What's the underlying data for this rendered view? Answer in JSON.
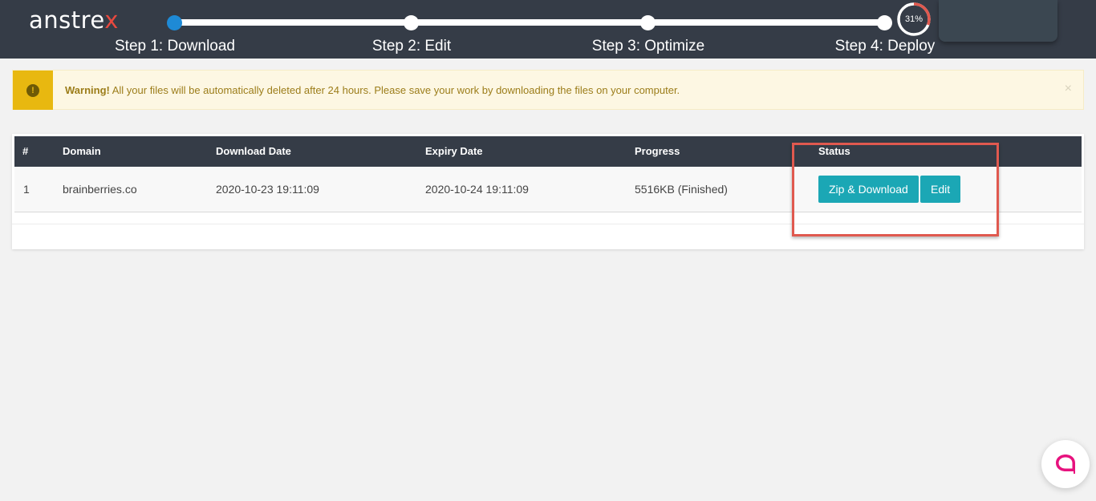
{
  "header": {
    "logo_main": "anstre",
    "logo_accent": "x",
    "steps": [
      {
        "label": "Step 1: Download"
      },
      {
        "label": "Step 2: Edit"
      },
      {
        "label": "Step 3: Optimize"
      },
      {
        "label": "Step 4: Deploy"
      }
    ],
    "progress_label": "31%",
    "progress_value": 31
  },
  "alert": {
    "title": "Warning!",
    "message": " All your files will be automatically deleted after 24 hours. Please save your work by downloading the files on your computer.",
    "close_label": "×"
  },
  "table": {
    "columns": [
      "#",
      "Domain",
      "Download Date",
      "Expiry Date",
      "Progress",
      "Status"
    ],
    "rows": [
      {
        "index": "1",
        "domain": "brainberries.co",
        "download_date": "2020-10-23 19:11:09",
        "expiry_date": "2020-10-24 19:11:09",
        "progress": "5516KB (Finished)",
        "zip_download_label": "Zip & Download",
        "edit_label": "Edit"
      }
    ]
  },
  "colors": {
    "header_bg": "#353c47",
    "active_step": "#1e8ad6",
    "warning": "#e8b810",
    "button": "#1ba7b5",
    "progress_ring": "#e0594f",
    "chat_icon": "#e7127e"
  }
}
